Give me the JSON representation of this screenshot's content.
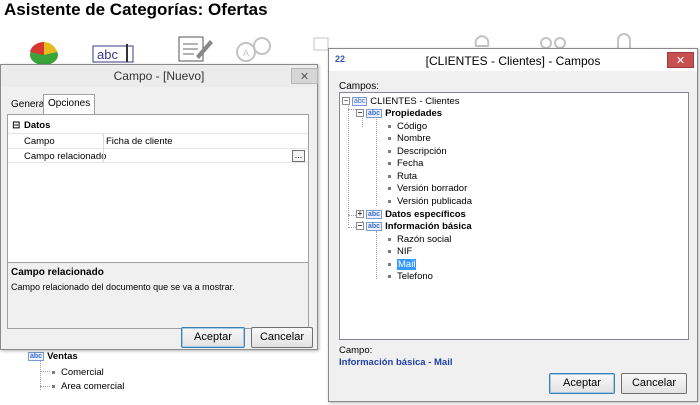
{
  "wizard": {
    "title": "Asistente de Categorías:  Ofertas",
    "icons": [
      "pie-chart-icon",
      "text-field-icon",
      "edit-form-icon",
      "link-icon",
      "document-icon",
      "folder-icon",
      "money-bag-icon",
      "glasses-icon",
      "padlock-icon"
    ]
  },
  "campo_dialog": {
    "title": "Campo - [Nuevo]",
    "tabs": [
      "General",
      "Opciones"
    ],
    "active_tab": "Opciones",
    "group": "Datos",
    "group_toggle": "⊟",
    "rows": [
      {
        "key": "Campo",
        "value": "Ficha de cliente"
      },
      {
        "key": "Campo relacionado",
        "value": ""
      }
    ],
    "ellipsis": "...",
    "desc_title": "Campo relacionado",
    "desc_text": "Campo relacionado del documento que se va a mostrar.",
    "accept": "Aceptar",
    "cancel": "Cancelar"
  },
  "background_tree": {
    "node": "Ventas",
    "children": [
      "Comercial",
      "Area comercial"
    ]
  },
  "campos_dialog": {
    "title": "[CLIENTES - Clientes] - Campos",
    "title_icon": "22",
    "fields_label": "Campos:",
    "root": "CLIENTES - Clientes",
    "groups": [
      {
        "label": "Propiedades",
        "expanded": true,
        "items": [
          "Código",
          "Nombre",
          "Descripción",
          "Fecha",
          "Ruta",
          "Versión borrador",
          "Versión publicada"
        ]
      },
      {
        "label": "Datos específicos",
        "expanded": false,
        "items": []
      },
      {
        "label": "Información básica",
        "expanded": true,
        "items": [
          "Razón social",
          "NIF",
          "Mail",
          "Telefono"
        ]
      }
    ],
    "selected_item": "Mail",
    "campo_label": "Campo:",
    "campo_value": "Información básica - Mail",
    "accept": "Aceptar",
    "cancel": "Cancelar",
    "abc": "abc",
    "close": "✕"
  },
  "colors": {
    "accent": "#3399ff",
    "close_red": "#c75050",
    "value_blue": "#1f3fa6"
  }
}
